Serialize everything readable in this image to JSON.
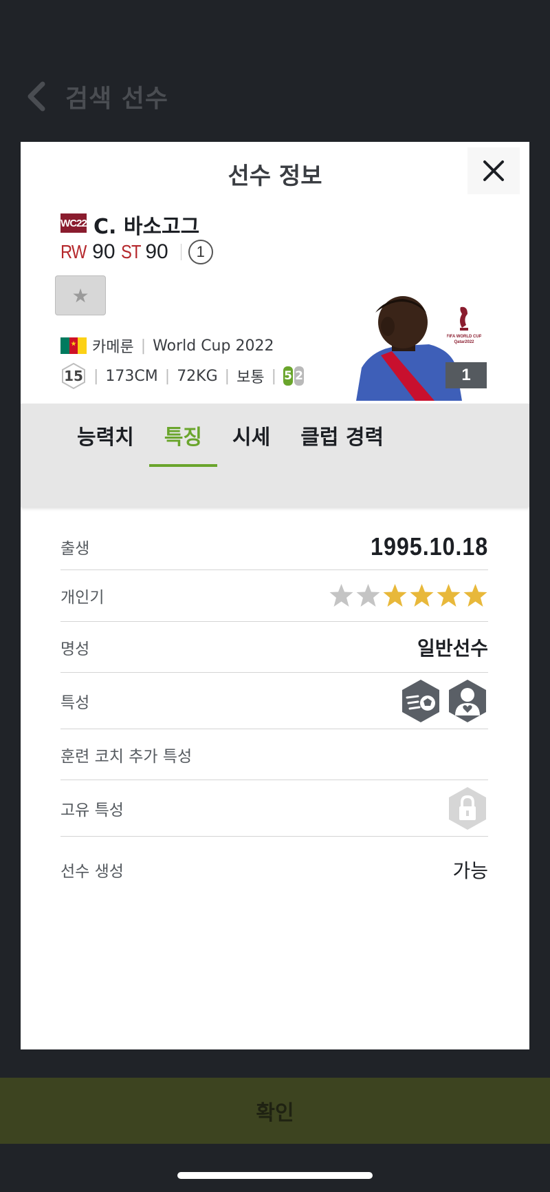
{
  "background": {
    "back_label": "검색 선수"
  },
  "modal": {
    "title": "선수 정보",
    "season_badge": "WC22",
    "player_name": "C. 바소고그",
    "positions": [
      {
        "pos": "RW",
        "ovr": "90"
      },
      {
        "pos": "ST",
        "ovr": "90"
      }
    ],
    "grade": "1",
    "nation": "카메룬",
    "season": "World Cup 2022",
    "number": "15",
    "height": "173CM",
    "weight": "72KG",
    "body_type": "보통",
    "foot_strong": "5",
    "foot_weak": "2",
    "level": "1",
    "world_cup_logo_text": "FIFA WORLD CUP Qatar2022"
  },
  "tabs": [
    "능력치",
    "특징",
    "시세",
    "클럽 경력"
  ],
  "active_tab": "특징",
  "info": {
    "birth_label": "출생",
    "birth_value": "1995.10.18",
    "popularity_label": "개인기",
    "popularity_stars": 4,
    "popularity_max": 6,
    "reputation_label": "명성",
    "reputation_value": "일반선수",
    "traits_label": "특성",
    "trait_icons": [
      "speed-dribbler-trait-icon",
      "team-player-trait-icon"
    ],
    "coach_traits_label": "훈련 코치 추가 특성",
    "unique_traits_label": "고유 특성",
    "creation_label": "선수 생성",
    "creation_value": "가능"
  },
  "confirm_label": "확인",
  "colors": {
    "accent_green": "#6aa52c",
    "position_red": "#b5282c",
    "star_gold": "#e8b83a",
    "star_gray": "#c4c4c4"
  }
}
